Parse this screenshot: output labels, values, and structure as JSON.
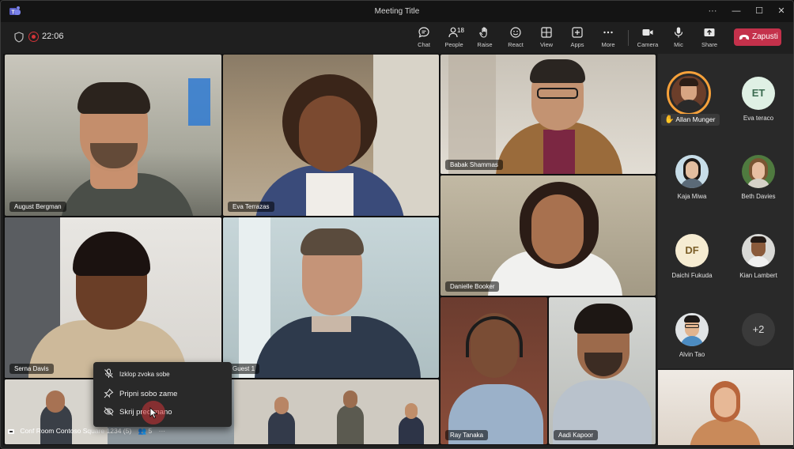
{
  "window": {
    "title": "Meeting Title",
    "controls": [
      "···",
      "—",
      "☐",
      "✕"
    ]
  },
  "toolbar": {
    "timer": "22:06",
    "buttons": [
      {
        "id": "chat",
        "label": "Chat",
        "icon": "chat-icon"
      },
      {
        "id": "people",
        "label": "People",
        "icon": "people-icon",
        "count": "18"
      },
      {
        "id": "raise",
        "label": "Raise",
        "icon": "raise-hand-icon"
      },
      {
        "id": "react",
        "label": "React",
        "icon": "smile-icon"
      },
      {
        "id": "view",
        "label": "View",
        "icon": "grid-icon"
      },
      {
        "id": "apps",
        "label": "Apps",
        "icon": "plus-icon"
      },
      {
        "id": "more",
        "label": "More",
        "icon": "ellipsis-icon"
      },
      {
        "id": "camera",
        "label": "Camera",
        "icon": "camera-icon"
      },
      {
        "id": "mic",
        "label": "Mic",
        "icon": "mic-icon"
      },
      {
        "id": "share",
        "label": "Share",
        "icon": "share-icon"
      }
    ],
    "leave_label": "Zapusti",
    "accent_leave": "#c4314b"
  },
  "stage": {
    "tiles": [
      {
        "name": "August Bergman"
      },
      {
        "name": "Eva Terrazas"
      },
      {
        "name": "Babak Shammas"
      },
      {
        "name": "Serna Davis"
      },
      {
        "name": "Guest 1"
      },
      {
        "name": "Danielle Booker"
      },
      {
        "name": "Ray Tanaka"
      },
      {
        "name": "Aadi Kapoor"
      }
    ],
    "room": {
      "label": "Conf Room Contoso Square 1234 (5)",
      "count": "5",
      "more": "···"
    }
  },
  "context_menu": {
    "items": [
      {
        "label": "Izklop zvoka sobe",
        "icon": "mic-off-icon"
      },
      {
        "label": "Pripni sobo zame",
        "icon": "pin-icon"
      },
      {
        "label": "Skrij pred mano",
        "icon": "eye-off-icon"
      }
    ]
  },
  "roster": {
    "people": [
      {
        "name": "Allan Munger",
        "raised_hand": true
      },
      {
        "name": "Eva teraco",
        "initials": "ET"
      },
      {
        "name": "Kaja Miwa"
      },
      {
        "name": "Beth Davies"
      },
      {
        "name": "Daichi Fukuda",
        "initials": "DF"
      },
      {
        "name": "Kian Lambert"
      },
      {
        "name": "Alvin Tao"
      },
      {
        "more": "+2"
      }
    ]
  }
}
